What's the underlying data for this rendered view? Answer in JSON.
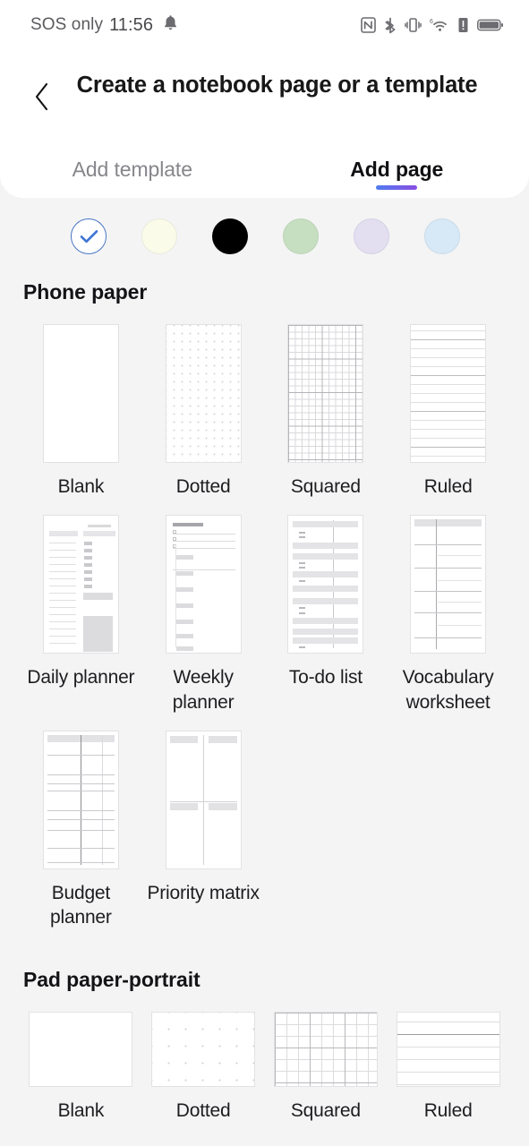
{
  "status_bar": {
    "carrier": "SOS only",
    "time": "11:56",
    "icons": [
      "bell-icon",
      "nfc-icon",
      "bluetooth-icon",
      "vibrate-icon",
      "wifi-6-icon",
      "alert-icon",
      "battery-icon"
    ],
    "wifi_generation": "6"
  },
  "header": {
    "back_label": "‹",
    "title": "Create a notebook page or a template",
    "tabs": [
      {
        "label": "Add template",
        "active": false
      },
      {
        "label": "Add page",
        "active": true
      }
    ],
    "indicator_gradient_from": "#4f7cf0",
    "indicator_gradient_to": "#8a4de2"
  },
  "colors": {
    "swatches": [
      {
        "name": "white",
        "hex": "#ffffff",
        "selected": true
      },
      {
        "name": "cream",
        "hex": "#fbfbe9",
        "selected": false
      },
      {
        "name": "black",
        "hex": "#000000",
        "selected": false
      },
      {
        "name": "green",
        "hex": "#c6dfc1",
        "selected": false
      },
      {
        "name": "lavender",
        "hex": "#e3dff1",
        "selected": false
      },
      {
        "name": "light-blue",
        "hex": "#d7e9f6",
        "selected": false
      }
    ],
    "selected_border": "#4775c4",
    "check_color": "#3c74d4"
  },
  "sections": [
    {
      "title": "Phone paper",
      "items": [
        {
          "label": "Blank",
          "pattern": "blank"
        },
        {
          "label": "Dotted",
          "pattern": "dotted"
        },
        {
          "label": "Squared",
          "pattern": "squared"
        },
        {
          "label": "Ruled",
          "pattern": "ruled"
        },
        {
          "label": "Daily planner",
          "pattern": "daily"
        },
        {
          "label": "Weekly planner",
          "pattern": "weekly"
        },
        {
          "label": "To-do list",
          "pattern": "todo"
        },
        {
          "label": "Vocabulary worksheet",
          "pattern": "vocab"
        },
        {
          "label": "Budget planner",
          "pattern": "budget"
        },
        {
          "label": "Priority matrix",
          "pattern": "matrix"
        }
      ]
    },
    {
      "title": "Pad paper-portrait",
      "items": [
        {
          "label": "Blank",
          "pattern": "blank"
        },
        {
          "label": "Dotted",
          "pattern": "dotted"
        },
        {
          "label": "Squared",
          "pattern": "squared"
        },
        {
          "label": "Ruled",
          "pattern": "ruled"
        }
      ]
    }
  ]
}
